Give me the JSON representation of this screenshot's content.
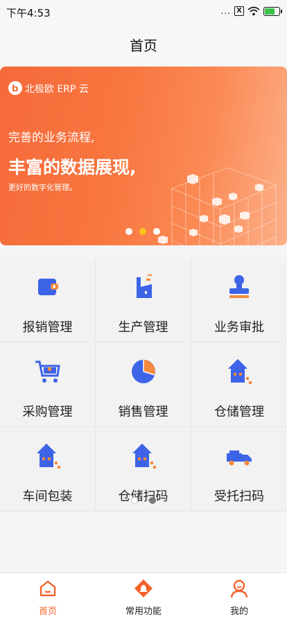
{
  "status_bar": {
    "time": "下午4:53",
    "dots": "...",
    "x_box": "X",
    "battery_level": 0.7
  },
  "nav": {
    "title": "首页"
  },
  "banner": {
    "logo_text": "北极欧 ERP 云",
    "line1": "完善的业务流程,",
    "line2": "丰富的数据展现,",
    "line3": "更好的数字化管理。",
    "pages": 3,
    "active_page": 2
  },
  "functions": [
    {
      "label": "报销管理",
      "icon": "wallet-icon"
    },
    {
      "label": "生产管理",
      "icon": "factory-icon"
    },
    {
      "label": "业务审批",
      "icon": "stamp-icon"
    },
    {
      "label": "采购管理",
      "icon": "cart-icon"
    },
    {
      "label": "销售管理",
      "icon": "pie-chart-icon"
    },
    {
      "label": "仓储管理",
      "icon": "warehouse-icon"
    },
    {
      "label": "车间包装",
      "icon": "warehouse-icon"
    },
    {
      "label": "仓储扫码",
      "icon": "warehouse-icon"
    },
    {
      "label": "受托扫码",
      "icon": "truck-icon"
    }
  ],
  "grid_pages": {
    "count": 2,
    "active": 2
  },
  "tabs": [
    {
      "label": "首页",
      "icon": "home-icon",
      "active": true
    },
    {
      "label": "常用功能",
      "icon": "bell-icon",
      "active": false
    },
    {
      "label": "我的",
      "icon": "user-icon",
      "active": false
    }
  ],
  "colors": {
    "accent": "#f5632b",
    "icon_blue": "#3d63e6",
    "banner_gradient_start": "#f56a3a",
    "banner_gradient_end": "#fcb08a",
    "active_dot": "#f7c21b"
  }
}
